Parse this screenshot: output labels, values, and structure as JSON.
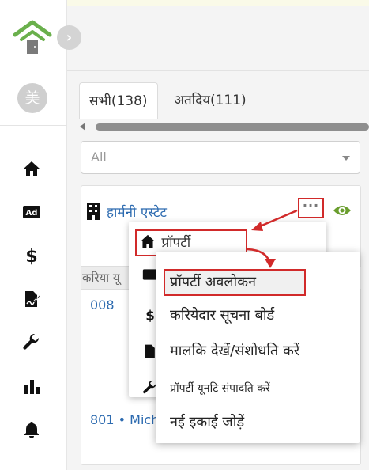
{
  "sidebar": {
    "avatar_initial": "美",
    "nav_icons": [
      "home-icon",
      "ad-icon",
      "dollar-icon",
      "contract-icon",
      "wrench-icon",
      "bar-chart-icon",
      "bell-icon"
    ]
  },
  "tabs": [
    {
      "label": "सभी(138)",
      "active": true
    },
    {
      "label": "अतदिय(111)",
      "active": false
    }
  ],
  "filter": {
    "selected": "All"
  },
  "property": {
    "name": "हार्मनी एस्टेट",
    "more_label": "···"
  },
  "table": {
    "header_partial": "करिया यू",
    "rows": [
      "008",
      "801 • Mich"
    ]
  },
  "menu_level1": {
    "item": "प्रॉपर्टी"
  },
  "menu_level2": {
    "items": [
      "प्रॉपर्टी अवलोकन",
      "करियेदार सूचना बोर्ड",
      "मालकि देखें/संशोधति करें",
      "प्रॉपर्टी यूनटि संपादति करें",
      "नई इकाई जोड़ें"
    ]
  },
  "colors": {
    "accent_blue": "#2d6bb0",
    "highlight_red": "#d12a2a",
    "logo_green": "#6ab04c",
    "eye_green": "#6a9e2e"
  }
}
